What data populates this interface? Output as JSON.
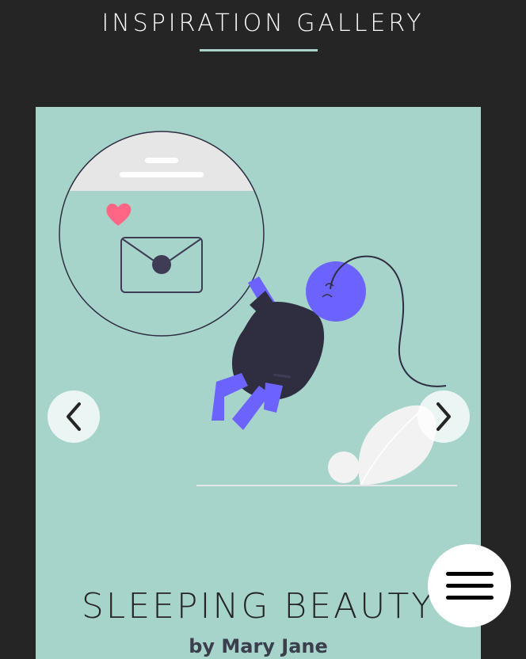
{
  "header": {
    "title": "INSPIRATION GALLERY"
  },
  "gallery": {
    "current_item": {
      "title": "SLEEPING BEAUTY",
      "author": "by Mary Jane",
      "image_icon": "sleeping-person-illustration-icon"
    },
    "prev_icon": "chevron-left-icon",
    "next_icon": "chevron-right-icon"
  },
  "menu": {
    "icon": "hamburger-menu-icon"
  },
  "colors": {
    "background": "#252525",
    "accent": "#a6d4cb",
    "figure_purple": "#6c63ff",
    "figure_dark": "#2f2e41",
    "heart": "#ff6584"
  }
}
